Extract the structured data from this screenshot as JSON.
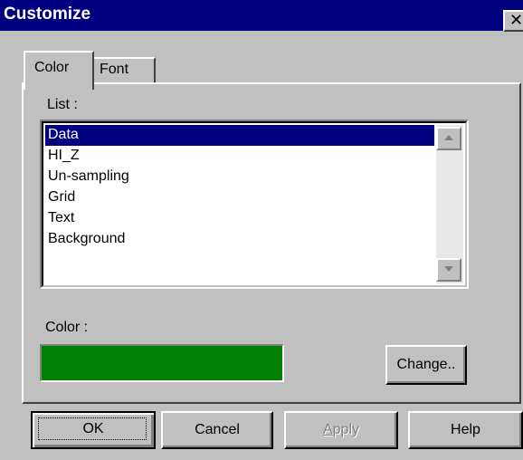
{
  "window": {
    "title": "Customize",
    "close_glyph": "✕"
  },
  "tabs": [
    {
      "label": "Color",
      "active": true
    },
    {
      "label": "Font",
      "active": false
    }
  ],
  "color_tab": {
    "list_label": "List :",
    "list_items": [
      "Data",
      "HI_Z",
      "Un-sampling",
      "Grid",
      "Text",
      "Background"
    ],
    "selected_item": "Data",
    "color_label": "Color :",
    "current_color": "#008000",
    "change_button": "Change.."
  },
  "scrollbar": {
    "up_icon": "scroll-up-arrow",
    "down_icon": "scroll-down-arrow"
  },
  "buttons": {
    "ok": "OK",
    "cancel": "Cancel",
    "apply": "Apply",
    "help": "Help"
  },
  "colors": {
    "titlebar": "#000080",
    "selection": "#000080",
    "face": "#c0c0c0"
  }
}
